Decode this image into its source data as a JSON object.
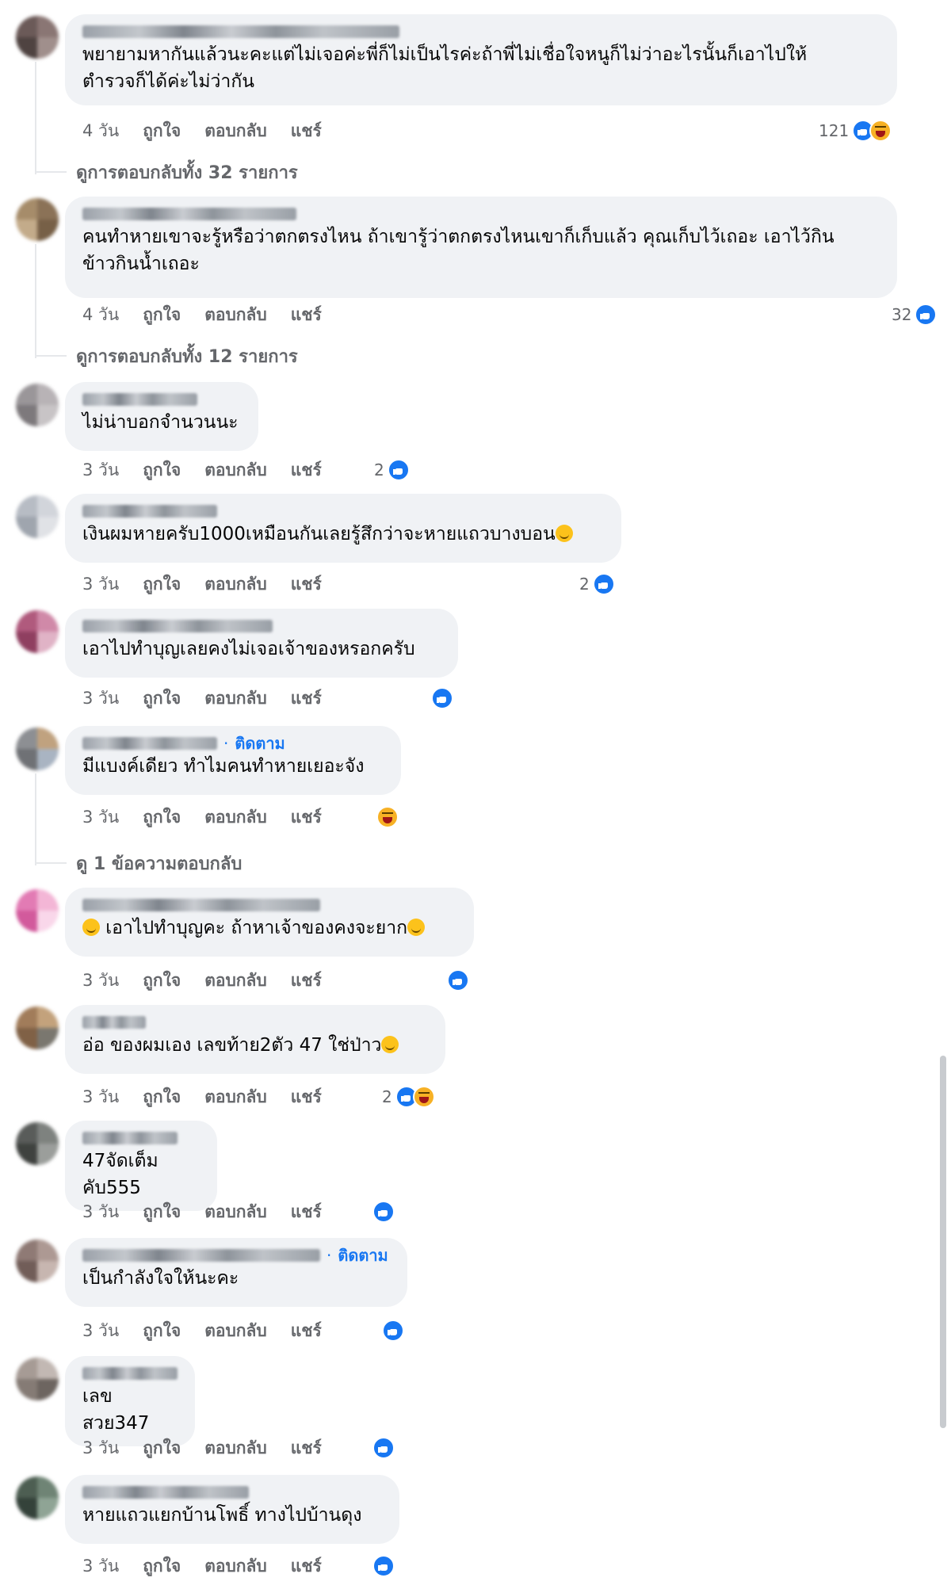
{
  "meta_labels": {
    "like": "ถูกใจ",
    "reply": "ตอบกลับ",
    "share": "แชร์"
  },
  "follow_label": "ติดตาม",
  "comments": [
    {
      "author": "xxxxxxxxxxxxxxxxxxxxxxxxxxxxxxxxx",
      "text": "พยายามหากันแล้วนะคะแต่ไม่เจอค่ะพี่ก็ไม่เป็นไรค่ะถ้าพี่ไม่เชื่อใจหนูก็ไม่ว่าอะไรนั้นก็เอาไปให้\nตำรวจก็ได้ค่ะไม่ว่ากัน",
      "time": "4 วัน",
      "reaction_count": "121",
      "reactions": [
        "like",
        "haha"
      ],
      "view_replies": "ดูการตอบกลับทั้ง 32 รายการ"
    },
    {
      "author": "xxxxxxxxxxxxxxxxxxxxxxxxxxxxxx",
      "text": "คนทำหายเขาจะรู้หรือว่าตกตรงไหน ถ้าเขารู้ว่าตกตรงไหนเขาก็เก็บแล้ว คุณเก็บไว้เถอะ เอาไว้กิน\nข้าวกินน้ำเถอะ",
      "time": "4 วัน",
      "reaction_count": "32",
      "reactions": [
        "like"
      ],
      "view_replies": "ดูการตอบกลับทั้ง 12 รายการ"
    },
    {
      "author": "xxxxxxxxxxxx",
      "text": "ไม่น่าบอกจำนวนนะ",
      "time": "3 วัน",
      "reaction_count": "2",
      "reactions": [
        "like"
      ]
    },
    {
      "author": "xxxxxxxxxxxxxxxxxx",
      "text": "เงินผมหายครับ1000เหมือนกันเลยรู้สึกว่าจะหายแถวบางบอน",
      "text_emoji": true,
      "time": "3 วัน",
      "reaction_count": "2",
      "reactions": [
        "like"
      ]
    },
    {
      "author": "xxxxxxxxxxxxxxxxxxxxxx",
      "text": "เอาไปทำบุญเลยคงไม่เจอเจ้าของหรอกครับ",
      "time": "3 วัน",
      "reaction_count": "",
      "reactions": [
        "like"
      ]
    },
    {
      "author": "xxxxxxxxxxxxxxx",
      "follow": true,
      "text": "มีแบงค์เดียว ทำไมคนทำหายเยอะจัง",
      "time": "3 วัน",
      "reaction_count": "",
      "reactions": [
        "haha"
      ],
      "view_replies": "ดู 1 ข้อความตอบกลับ"
    },
    {
      "author": "xxxxxxxxxxxxxxxxxxxxxxxxx",
      "text": " เอาไปทำบุญคะ ถ้าหาเจ้าของคงจะยาก",
      "text_emoji_start": true,
      "text_emoji": true,
      "time": "3 วัน",
      "reaction_count": "",
      "reactions": [
        "like"
      ]
    },
    {
      "author": "xxxxxx",
      "text": "อ่อ ของผมเอง เลขท้าย2ตัว 47 ใช่ป่าว",
      "text_emoji": true,
      "time": "3 วัน",
      "reaction_count": "2",
      "reactions": [
        "like",
        "haha"
      ]
    },
    {
      "author": "xxxxxxx",
      "text": "47จัดเต็มคับ555",
      "time": "3 วัน",
      "reaction_count": "",
      "reactions": [
        "like"
      ]
    },
    {
      "author": "xxxxxxxxxxxxxxxxxxxxxxxxxxx",
      "follow": true,
      "text": "เป็นกำลังใจให้นะคะ",
      "time": "3 วัน",
      "reaction_count": "",
      "reactions": [
        "like"
      ]
    },
    {
      "author": "xxxxxxxx",
      "text": "เลขสวย347",
      "time": "3 วัน",
      "reaction_count": "",
      "reactions": [
        "like"
      ]
    },
    {
      "author": "xxxxxxxxxxxxxx",
      "text": "หายแถวแยกบ้านโพธิ์ ทางไปบ้านดุง",
      "time": "3 วัน",
      "reaction_count": "",
      "reactions": [
        "like"
      ]
    }
  ],
  "colors": {
    "bubble": "#f0f2f5",
    "meta_text": "#65676b",
    "like_blue": "#1877f2",
    "haha_yellow": "#f7b125",
    "text": "#050505"
  },
  "icons": {
    "like": "like-reaction-icon",
    "haha": "haha-reaction-icon"
  }
}
